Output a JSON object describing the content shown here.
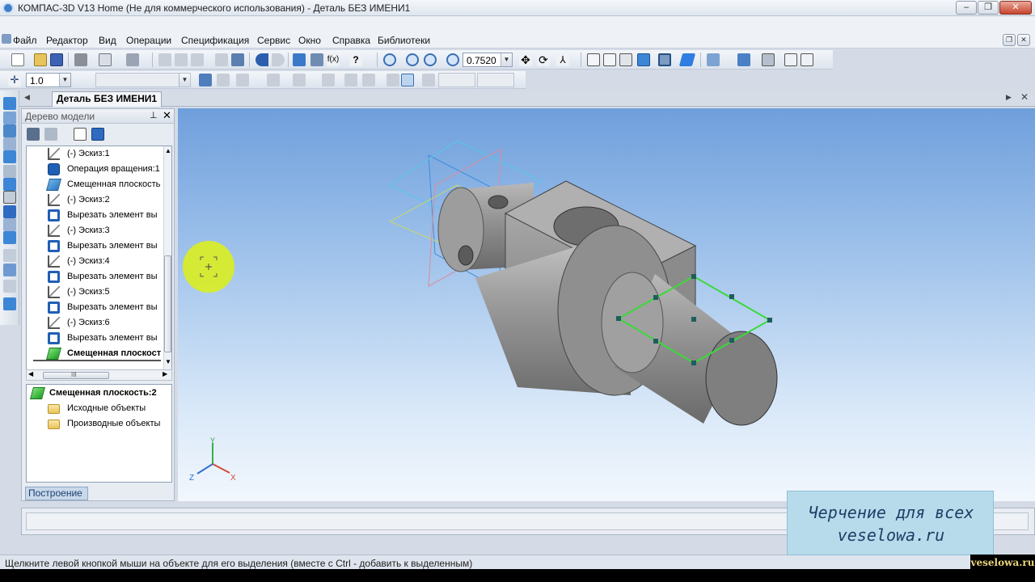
{
  "app": {
    "title": "КОМПАС-3D V13 Home (Не для коммерческого использования) - Деталь БЕЗ ИМЕНИ1"
  },
  "window_buttons": {
    "minimize": "‒",
    "maximize": "❐",
    "close": "✕"
  },
  "menu": [
    {
      "label": "Файл"
    },
    {
      "label": "Редактор"
    },
    {
      "label": "Вид"
    },
    {
      "label": "Операции"
    },
    {
      "label": "Спецификация"
    },
    {
      "label": "Сервис"
    },
    {
      "label": "Окно"
    },
    {
      "label": "Справка"
    },
    {
      "label": "Библиотеки"
    }
  ],
  "toolbar": {
    "zoom_value": "0.7520",
    "step_value": "1.0"
  },
  "doc_tab": {
    "label": "Деталь БЕЗ ИМЕНИ1"
  },
  "tree": {
    "header": "Дерево модели",
    "items": [
      {
        "label": "(-) Эскиз:1",
        "icon": "sketch-icon"
      },
      {
        "label": "Операция вращения:1",
        "icon": "rotation-icon"
      },
      {
        "label": "Смещенная плоскость",
        "icon": "plane-icon"
      },
      {
        "label": "(-) Эскиз:2",
        "icon": "sketch-icon"
      },
      {
        "label": "Вырезать элемент вы",
        "icon": "cut-icon"
      },
      {
        "label": "(-) Эскиз:3",
        "icon": "sketch-icon"
      },
      {
        "label": "Вырезать элемент вы",
        "icon": "cut-icon"
      },
      {
        "label": "(-) Эскиз:4",
        "icon": "sketch-icon"
      },
      {
        "label": "Вырезать элемент вы",
        "icon": "cut-icon"
      },
      {
        "label": "(-) Эскиз:5",
        "icon": "sketch-icon"
      },
      {
        "label": "Вырезать элемент вы",
        "icon": "cut-icon"
      },
      {
        "label": "(-) Эскиз:6",
        "icon": "sketch-icon"
      },
      {
        "label": "Вырезать элемент вы",
        "icon": "cut-icon"
      },
      {
        "label": "Смещенная плоскост",
        "icon": "plane-green-icon",
        "bold": true
      }
    ],
    "hscroll_label": "III",
    "properties": {
      "root": "Смещенная плоскость:2",
      "children": [
        "Исходные объекты",
        "Производные объекты"
      ]
    },
    "bottom_tab": "Построение"
  },
  "viewport": {
    "axis_labels": {
      "x": "X",
      "y": "Y",
      "z": "Z"
    }
  },
  "status": {
    "hint": "Щелкните левой кнопкой мыши на объекте для его выделения (вместе с Ctrl - добавить к выделенным)"
  },
  "watermark": {
    "line1": "Черчение для всех",
    "line2": "veselowa.ru",
    "badge": "veselowa.ru"
  }
}
